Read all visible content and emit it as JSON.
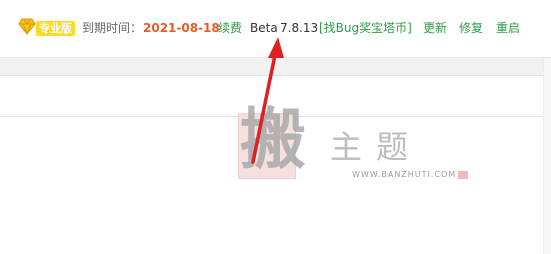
{
  "status_bar": {
    "edition_badge": "专业版",
    "gem_icon": "diamond-icon",
    "expire_label": "到期时间：",
    "expire_date": "2021-08-18",
    "renew_link": "续费",
    "beta_label": "Beta",
    "version": "7.8.13",
    "bug_bounty_link": "[找Bug奖宝塔币]",
    "update_link": "更新",
    "repair_link": "修复",
    "restart_link": "重启"
  },
  "watermark": {
    "big_char": "搬",
    "title": "主题",
    "url": "WWW.BANZHUTI.COM"
  },
  "colors": {
    "badge": "#ffd92a",
    "date": "#e55d26",
    "link": "#2e9e47",
    "arrow": "#e02020"
  }
}
